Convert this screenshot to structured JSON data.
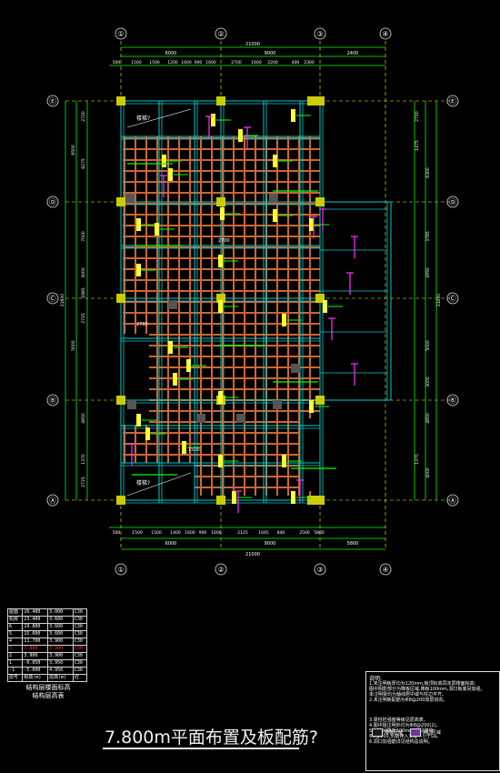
{
  "drawing": {
    "title": "7.800m平面布置及板配筋?",
    "axes_top": [
      "①",
      "②",
      "③",
      "④"
    ],
    "axes_left": [
      "Ⓔ",
      "Ⓓ",
      "Ⓒ",
      "Ⓑ",
      "Ⓐ"
    ],
    "dims_top_total": "21000",
    "dims_top_mid": [
      "6000",
      "9000",
      "2400"
    ],
    "dims_top_small": [
      "500",
      "1500",
      "1500",
      "1200",
      "1600",
      "900",
      "1600",
      "2700",
      "1600",
      "2200",
      "400",
      "2300"
    ],
    "dims_bottom_small": [
      "500",
      "1500",
      "1500",
      "1400",
      "1600",
      "900",
      "1600",
      "2125",
      "1045",
      "840",
      "2500",
      "5800"
    ],
    "dims_bottom_mid": [
      "6000",
      "9000",
      "5800"
    ],
    "dims_bottom_total": "21000",
    "dims_left": [
      "2720",
      "6275",
      "8500",
      "7000",
      "3000",
      "1685",
      "21600",
      "2725",
      "5000",
      "4850",
      "1370",
      "2725"
    ],
    "dims_right": [
      "2720",
      "1475",
      "6300",
      "3785",
      "4950",
      "21000",
      "5000",
      "3000",
      "4850",
      "1370",
      "4000"
    ],
    "room_labels": [
      "楼梯?",
      "楼梯?"
    ],
    "slab_notes": [
      "2700",
      "2700",
      "1500"
    ]
  },
  "floor_table": {
    "rows": [
      [
        "屋面",
        "26.400",
        "3.000",
        "C30"
      ],
      [
        "机房",
        "23.400",
        "3.600",
        "C30"
      ],
      [
        "6",
        "19.800",
        "3.600",
        "C30"
      ],
      [
        "5",
        "15.600",
        "3.600",
        "C30"
      ],
      [
        "4",
        "11.700",
        "3.900",
        "C30"
      ],
      [
        "3",
        "7.800",
        "3.900",
        "C30"
      ],
      [
        "2",
        "3.900",
        "3.900",
        "C30"
      ],
      [
        "1",
        "-0.050",
        "3.950",
        "C30"
      ],
      [
        "-1",
        "-5.000",
        "4.950",
        "C30"
      ]
    ],
    "header": [
      "层号",
      "标高(m)",
      "层高(m)",
      "砼"
    ],
    "caption_1": "结构层楼面标高",
    "caption_2": "结构层高表",
    "selected_index": 5
  },
  "notes": {
    "heading": "说明:",
    "lines": [
      "1.未注明板厚均为120mm,板顶标高同本层楼面标高;",
      "  图中阴影部分为降板区域,降板100mm,洞口板底另加强。",
      "  未注明梁均为轴线居中或与柱边平齐。",
      "2.未注明板配筋为Φ8@200双层双向。",
      "3.梁柱砼强度等级见层高表。",
      "4.图中除注明外均为Φ8@200(2)。",
      "5.卫生间降板100mm,详见建施;",
      "  Φ8@200,负筋伸入支座不小于La。",
      "6.洞口加强筋详见结构总说明。"
    ],
    "legend_1": "降板区域",
    "legend_2": "洞口区域"
  },
  "colors": {
    "beam": "#00cccc",
    "grid": "#ffff00",
    "slab": "#cc6633",
    "dim": "#00ff00",
    "rebar": "#ff33ff",
    "column": "#cccc00"
  }
}
